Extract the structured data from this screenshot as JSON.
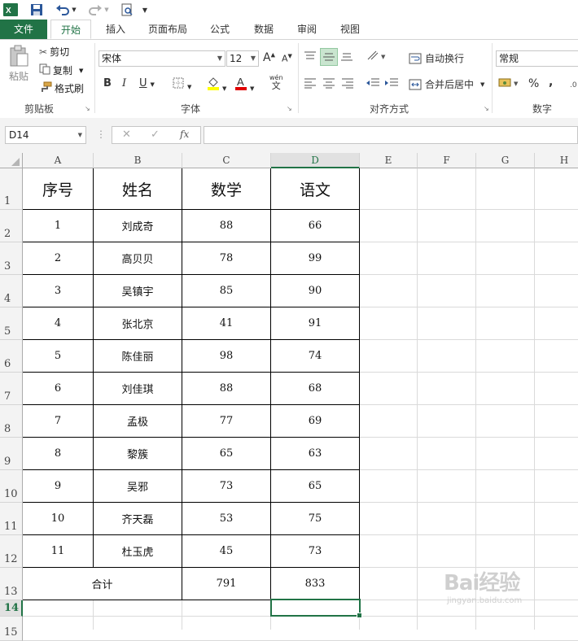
{
  "qat": {
    "undo_icon": "undo-icon",
    "redo_icon": "redo-icon"
  },
  "tabs": [
    "文件",
    "开始",
    "插入",
    "页面布局",
    "公式",
    "数据",
    "审阅",
    "视图"
  ],
  "ribbon": {
    "clipboard": {
      "paste": "粘贴",
      "cut": "剪切",
      "copy": "复制",
      "format_painter": "格式刷",
      "group": "剪贴板"
    },
    "font": {
      "name": "宋体",
      "size": "12",
      "bold": "B",
      "italic": "I",
      "underline": "U",
      "grow": "A",
      "shrink": "A",
      "group": "字体",
      "phonetic_top": "wén",
      "phonetic_bottom": "文"
    },
    "alignment": {
      "wrap": "自动换行",
      "merge": "合并后居中",
      "group": "对齐方式"
    },
    "number": {
      "format": "常规",
      "percent": "%",
      "comma": ",",
      "group": "数字"
    }
  },
  "formula_bar": {
    "name_box": "D14",
    "fx": "fx",
    "cancel": "✕",
    "enter": "✓",
    "value": ""
  },
  "columns": [
    "A",
    "B",
    "C",
    "D",
    "E",
    "F",
    "G",
    "H"
  ],
  "rows": [
    "1",
    "2",
    "3",
    "4",
    "5",
    "6",
    "7",
    "8",
    "9",
    "10",
    "11",
    "12",
    "13",
    "14",
    "15"
  ],
  "table": {
    "headers": [
      "序号",
      "姓名",
      "数学",
      "语文"
    ],
    "rows": [
      [
        "1",
        "刘成奇",
        "88",
        "66"
      ],
      [
        "2",
        "高贝贝",
        "78",
        "99"
      ],
      [
        "3",
        "吴镇宇",
        "85",
        "90"
      ],
      [
        "4",
        "张北京",
        "41",
        "91"
      ],
      [
        "5",
        "陈佳丽",
        "98",
        "74"
      ],
      [
        "6",
        "刘佳琪",
        "88",
        "68"
      ],
      [
        "7",
        "孟极",
        "77",
        "69"
      ],
      [
        "8",
        "黎簇",
        "65",
        "63"
      ],
      [
        "9",
        "吴邪",
        "73",
        "65"
      ],
      [
        "10",
        "齐天磊",
        "53",
        "75"
      ],
      [
        "11",
        "杜玉虎",
        "45",
        "73"
      ]
    ],
    "total_label": "合计",
    "total_math": "791",
    "total_chinese": "833"
  },
  "watermark": {
    "main": "Bai经验",
    "sub": "jingyan.baidu.com"
  },
  "colors": {
    "excel_green": "#217346",
    "header_bg": "#f3f3f3",
    "gridline": "#dadada"
  }
}
